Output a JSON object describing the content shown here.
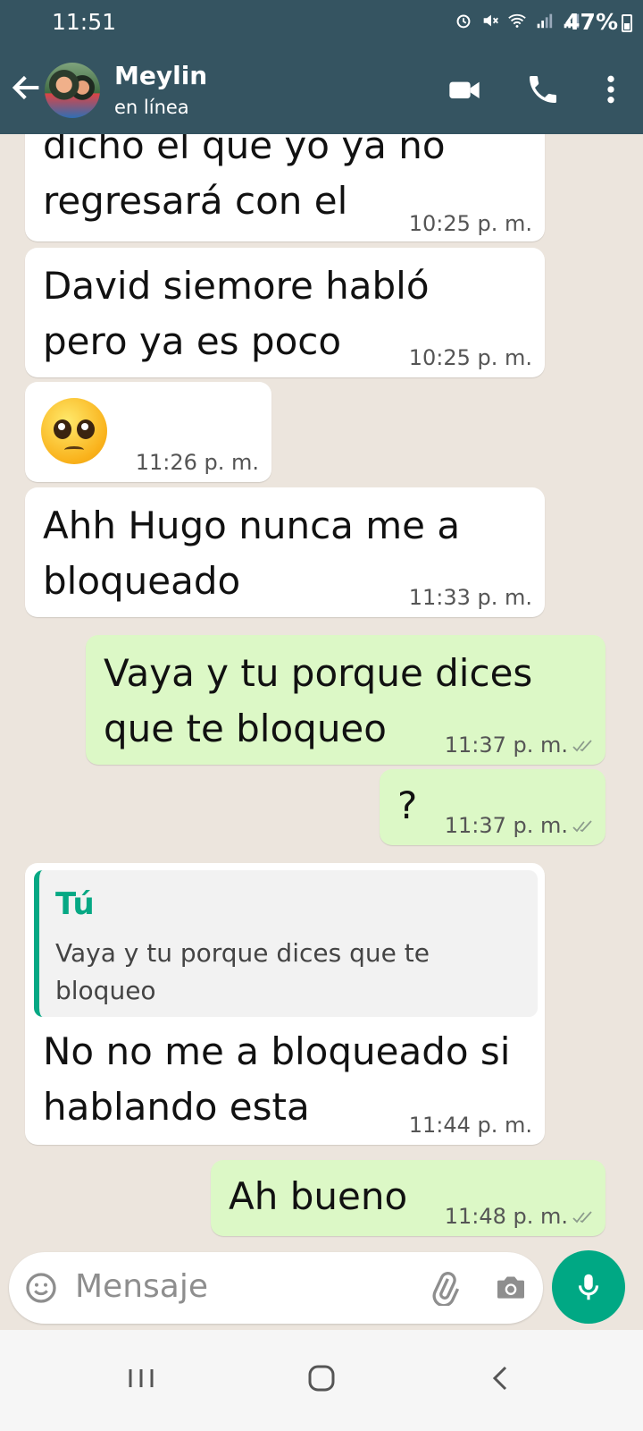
{
  "status_bar": {
    "time": "11:51",
    "battery": "47%"
  },
  "header": {
    "contact_name": "Meylin",
    "contact_status": "en línea"
  },
  "messages": [
    {
      "id": "m1",
      "direction": "incoming",
      "lines": [
        "dicho el que yo ya no",
        "regresará con el"
      ],
      "time": "10:25 p. m."
    },
    {
      "id": "m2",
      "direction": "incoming",
      "lines": [
        "David siemore habló",
        "pero ya es poco"
      ],
      "time": "10:25 p. m."
    },
    {
      "id": "m3",
      "direction": "incoming",
      "emoji": "pleading-face-emoji",
      "time": "11:26 p. m."
    },
    {
      "id": "m4",
      "direction": "incoming",
      "lines": [
        "Ahh Hugo nunca me a",
        "bloqueado"
      ],
      "time": "11:33 p. m."
    },
    {
      "id": "m5",
      "direction": "outgoing",
      "lines": [
        "Vaya y tu porque dices",
        "que te bloqueo"
      ],
      "time": "11:37 p. m."
    },
    {
      "id": "m6",
      "direction": "outgoing",
      "lines": [
        "?"
      ],
      "time": "11:37 p. m."
    },
    {
      "id": "m7",
      "direction": "incoming",
      "quote": {
        "author": "Tú",
        "lines": [
          "Vaya y tu porque dices que te",
          "bloqueo"
        ]
      },
      "lines": [
        "No no me a bloqueado si",
        "hablando esta"
      ],
      "time": "11:44 p. m."
    },
    {
      "id": "m8",
      "direction": "outgoing",
      "lines": [
        "Ah bueno"
      ],
      "time": "11:48 p. m."
    }
  ],
  "composer": {
    "placeholder": "Mensaje"
  },
  "colors": {
    "header": "#355461",
    "outgoing_bubble": "#dcf8c6",
    "incoming_bubble": "#ffffff",
    "accent": "#00a884"
  }
}
